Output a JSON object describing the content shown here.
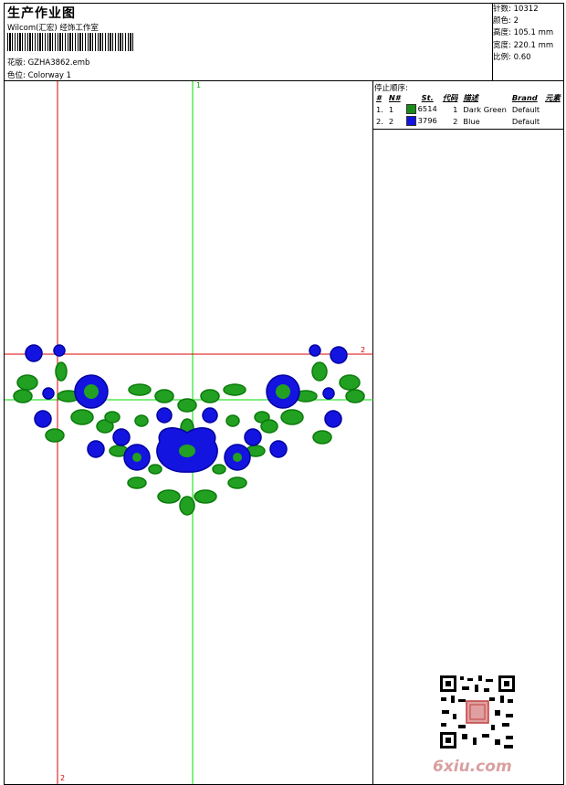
{
  "header": {
    "title": "生产作业图",
    "company": "Wilcom(汇宏) 经饰工作室",
    "design_label": "花版:",
    "design_value": "GZHA3862.emb",
    "colorway_label": "色位:",
    "colorway_value": "Colorway 1"
  },
  "stats": [
    {
      "label": "针数:",
      "value": "10312"
    },
    {
      "label": "颜色:",
      "value": "2"
    },
    {
      "label": "高度:",
      "value": "105.1 mm"
    },
    {
      "label": "宽度:",
      "value": "220.1 mm"
    },
    {
      "label": "比例:",
      "value": "0.60"
    }
  ],
  "stop_sequence": {
    "title": "停止顺序:",
    "columns": [
      "#",
      "N#",
      "St.",
      "代码",
      "描述",
      "Brand",
      "元素"
    ],
    "rows": [
      {
        "num": "1.",
        "needle": "1",
        "color": "#1a8c1a",
        "stitch": "6514",
        "code": "1",
        "desc": "Dark Green",
        "brand": "Default"
      },
      {
        "num": "2.",
        "needle": "2",
        "color": "#1414e0",
        "stitch": "3796",
        "code": "2",
        "desc": "Blue",
        "brand": "Default"
      }
    ]
  },
  "guides": {
    "green_v_label": "1",
    "red_h_label": "2",
    "red_v_label": "2"
  },
  "watermark": "6xiu.com"
}
